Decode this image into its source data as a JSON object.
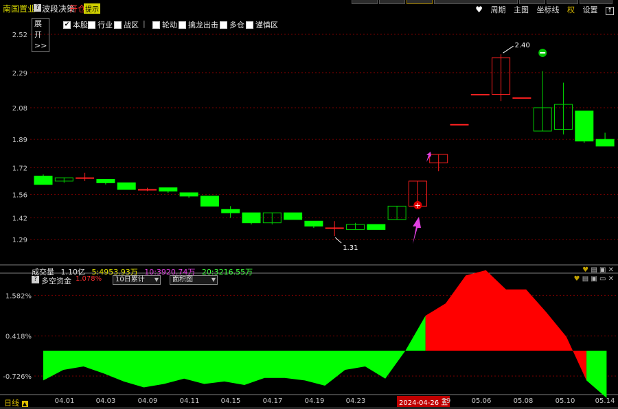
{
  "header": {
    "stock_name": "南国置业",
    "tag": "?",
    "strategy": "波段决策",
    "signal": "开仓",
    "hint": "提示",
    "tools": [
      "周期",
      "主图",
      "坐标线",
      "权",
      "设置"
    ]
  },
  "toolbar": {
    "expand": "展开>>",
    "options": [
      {
        "label": "本股",
        "checked": true
      },
      {
        "label": "行业",
        "checked": false
      },
      {
        "label": "战区",
        "checked": false
      },
      {
        "label": "轮动",
        "checked": false
      },
      {
        "label": "擒龙出击",
        "checked": false
      },
      {
        "label": "多仓",
        "checked": false
      },
      {
        "label": "谨慎区",
        "checked": false
      }
    ],
    "separator": "|"
  },
  "price_axis": {
    "ticks": [
      "2.52",
      "2.29",
      "2.08",
      "1.89",
      "1.72",
      "1.56",
      "1.42",
      "1.29"
    ]
  },
  "volume": {
    "label": "成交量",
    "value": "1.10亿",
    "ma5": "5:4953.93万",
    "ma10": "10:3920.74万",
    "ma20": "20:3216.55万"
  },
  "indicator": {
    "name": "多空资金",
    "value": "1.078%",
    "period_select": "10日累计",
    "style_select": "面积图",
    "ticks": [
      "1.582%",
      "0.418%",
      "-0.726%"
    ]
  },
  "x_axis": {
    "labels": [
      "04.01",
      "04.03",
      "04.09",
      "04.11",
      "04.15",
      "04.17",
      "04.19",
      "04.23",
      "05.06",
      "05.08",
      "05.10",
      "05.14"
    ],
    "current_date": "2024-04-26 五",
    "partial_label": "29"
  },
  "bottom_label": "日线",
  "chart_data": [
    {
      "type": "candlestick",
      "title": "",
      "ylim": [
        1.2,
        2.56
      ],
      "y_ticks": [
        2.52,
        2.29,
        2.08,
        1.89,
        1.72,
        1.56,
        1.42,
        1.29
      ],
      "annotations": [
        "2.40",
        "1.31"
      ],
      "candles": [
        {
          "o": 1.67,
          "h": 1.68,
          "l": 1.62,
          "c": 1.62
        },
        {
          "o": 1.64,
          "h": 1.66,
          "l": 1.63,
          "c": 1.66
        },
        {
          "o": 1.66,
          "h": 1.69,
          "l": 1.64,
          "c": 1.66
        },
        {
          "o": 1.65,
          "h": 1.65,
          "l": 1.62,
          "c": 1.63
        },
        {
          "o": 1.63,
          "h": 1.63,
          "l": 1.59,
          "c": 1.59
        },
        {
          "o": 1.59,
          "h": 1.6,
          "l": 1.58,
          "c": 1.59
        },
        {
          "o": 1.6,
          "h": 1.6,
          "l": 1.57,
          "c": 1.58
        },
        {
          "o": 1.57,
          "h": 1.57,
          "l": 1.54,
          "c": 1.55
        },
        {
          "o": 1.55,
          "h": 1.55,
          "l": 1.49,
          "c": 1.49
        },
        {
          "o": 1.47,
          "h": 1.49,
          "l": 1.42,
          "c": 1.45
        },
        {
          "o": 1.45,
          "h": 1.45,
          "l": 1.38,
          "c": 1.39
        },
        {
          "o": 1.39,
          "h": 1.45,
          "l": 1.38,
          "c": 1.45
        },
        {
          "o": 1.45,
          "h": 1.45,
          "l": 1.41,
          "c": 1.41
        },
        {
          "o": 1.4,
          "h": 1.4,
          "l": 1.36,
          "c": 1.37
        },
        {
          "o": 1.36,
          "h": 1.4,
          "l": 1.31,
          "c": 1.36
        },
        {
          "o": 1.35,
          "h": 1.39,
          "l": 1.35,
          "c": 1.38
        },
        {
          "o": 1.38,
          "h": 1.38,
          "l": 1.35,
          "c": 1.35
        },
        {
          "o": 1.41,
          "h": 1.49,
          "l": 1.41,
          "c": 1.49
        },
        {
          "o": 1.49,
          "h": 1.64,
          "l": 1.49,
          "c": 1.64
        },
        {
          "o": 1.75,
          "h": 1.8,
          "l": 1.7,
          "c": 1.8
        },
        {
          "o": 1.98,
          "h": 1.98,
          "l": 1.98,
          "c": 1.98
        },
        {
          "o": 2.16,
          "h": 2.16,
          "l": 2.16,
          "c": 2.16
        },
        {
          "o": 2.16,
          "h": 2.4,
          "l": 2.12,
          "c": 2.38
        },
        {
          "o": 2.14,
          "h": 2.14,
          "l": 2.14,
          "c": 2.14
        },
        {
          "o": 1.94,
          "h": 2.3,
          "l": 1.94,
          "c": 2.08
        },
        {
          "o": 1.95,
          "h": 2.23,
          "l": 1.92,
          "c": 2.1
        },
        {
          "o": 2.06,
          "h": 2.06,
          "l": 1.87,
          "c": 1.88
        },
        {
          "o": 1.89,
          "h": 1.93,
          "l": 1.85,
          "c": 1.85
        }
      ]
    },
    {
      "type": "area",
      "title": "多空资金",
      "ylim": [
        -1.45,
        2.35
      ],
      "values": [
        -0.85,
        -0.55,
        -0.45,
        -0.65,
        -0.88,
        -1.05,
        -0.95,
        -0.8,
        -0.95,
        -0.88,
        -0.98,
        -0.78,
        -0.78,
        -0.85,
        -1.0,
        -0.55,
        -0.45,
        -0.8,
        0.0,
        1.0,
        1.35,
        2.15,
        2.3,
        1.75,
        1.75,
        1.1,
        0.4,
        -0.85,
        -1.35
      ]
    }
  ]
}
